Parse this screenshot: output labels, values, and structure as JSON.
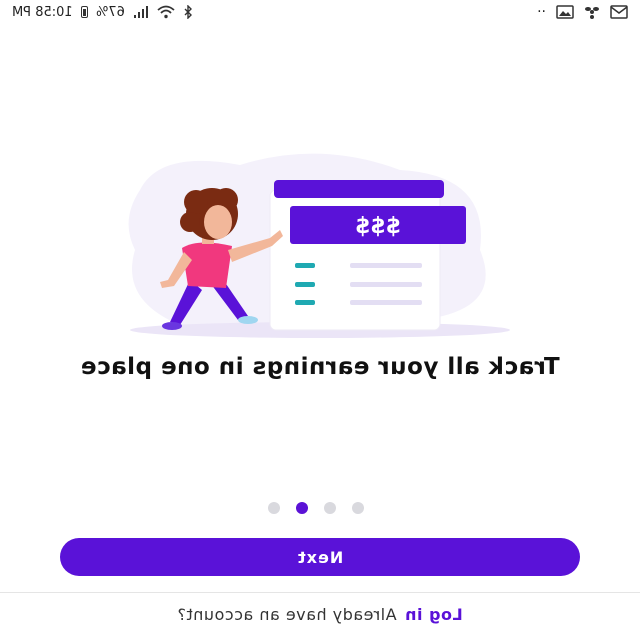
{
  "status_bar": {
    "time": "10:58 PM",
    "battery": "67%",
    "icons": [
      "bluetooth-icon",
      "wifi-icon",
      "signal-icon",
      "battery-icon",
      "image-icon",
      "mail-icon",
      "fan-icon",
      "more-icon"
    ]
  },
  "illustration": {
    "card_text": "$$$"
  },
  "onboarding": {
    "headline": "Track all your earnings in one place",
    "page_count": 4,
    "active_page": 2
  },
  "actions": {
    "next_label": "Next",
    "account_prompt": "Already have an account?",
    "login_label": "Log in"
  },
  "colors": {
    "accent": "#5A12D8",
    "dot_inactive": "#D9D9DE",
    "teal": "#1FA9B2",
    "skin": "#F2B79A",
    "shirt": "#F1387E",
    "hair": "#7A2B12"
  }
}
